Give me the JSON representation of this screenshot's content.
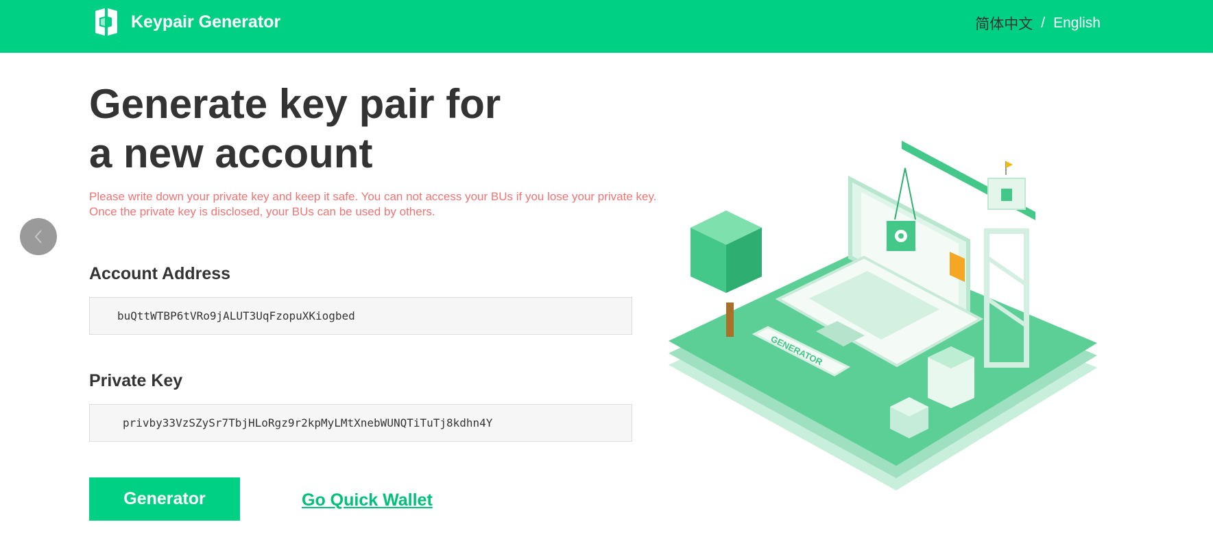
{
  "header": {
    "app_title": "Keypair Generator",
    "logo_icon": "keypair-logo-icon",
    "languages": {
      "chinese": "简体中文",
      "separator": "/",
      "english": "English"
    }
  },
  "hero": {
    "title": "Generate key pair for\na new account",
    "warning_line1": "Please write down your private key and keep it safe. You can not access your BUs if you lose your private key.",
    "warning_line2": "Once the private key is disclosed, your BUs can be used by others."
  },
  "fields": {
    "address_label": "Account Address",
    "address_value": "buQttWTBP6tVRo9jALUT3UqFzopuXKiogbed",
    "private_key_label": "Private Key",
    "private_key_value": "privby33VzSZySr7TbjHLoRgz9r2kpMyLMtXnebWUNQTiTuTj8kdhn4Y"
  },
  "actions": {
    "generate_label": "Generator",
    "wallet_link_label": "Go Quick Wallet",
    "back_icon": "chevron-left-icon"
  },
  "illustration": {
    "board_text": "GENERATOR"
  },
  "colors": {
    "brand_green": "#00d084",
    "link_green": "#00c07a",
    "warning_red": "#f07474",
    "text_dark": "#333333"
  }
}
